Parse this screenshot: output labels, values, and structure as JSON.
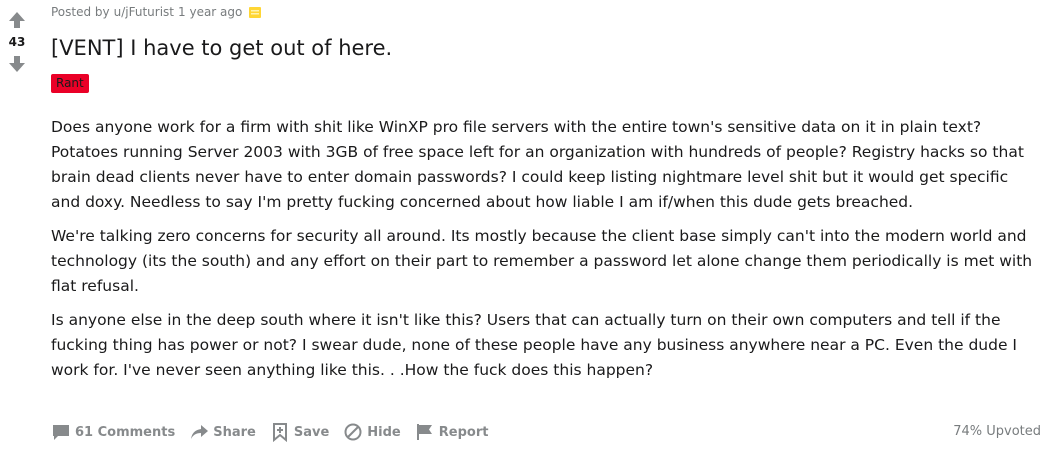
{
  "vote": {
    "score": "43"
  },
  "post": {
    "posted_by_prefix": "Posted by",
    "author": "u/jFuturist",
    "time": "1 year ago",
    "title": "[VENT] I have to get out of here.",
    "flair": "Rant",
    "paragraphs": [
      "Does anyone work for a firm with shit like WinXP pro file servers with the entire town's sensitive data on it in plain text? Potatoes running Server 2003 with 3GB of free space left for an organization with hundreds of people? Registry hacks so that brain dead clients never have to enter domain passwords? I could keep listing nightmare level shit but it would get specific and doxy. Needless to say I'm pretty fucking concerned about how liable I am if/when this dude gets breached.",
      "We're talking zero concerns for security all around. Its mostly because the client base simply can't into the modern world and technology (its the south) and any effort on their part to remember a password let alone change them periodically is met with flat refusal.",
      "Is anyone else in the deep south where it isn't like this? Users that can actually turn on their own computers and tell if the fucking thing has power or not? I swear dude, none of these people have any business anywhere near a PC. Even the dude I work for. I've never seen anything like this. . .How the fuck does this happen?"
    ]
  },
  "actions": {
    "comments": "61 Comments",
    "share": "Share",
    "save": "Save",
    "hide": "Hide",
    "report": "Report",
    "upvoted": "74% Upvoted"
  },
  "colors": {
    "flair_bg": "#ea0027",
    "meta_text": "#787c7e",
    "action_text": "#878a8c",
    "award_yellow": "#ffd635"
  },
  "icons": {
    "upvote": "arrow-up-icon",
    "downvote": "arrow-down-icon",
    "award": "award-icon",
    "comments": "comment-icon",
    "share": "share-icon",
    "save": "bookmark-icon",
    "hide": "hide-icon",
    "report": "flag-icon"
  }
}
